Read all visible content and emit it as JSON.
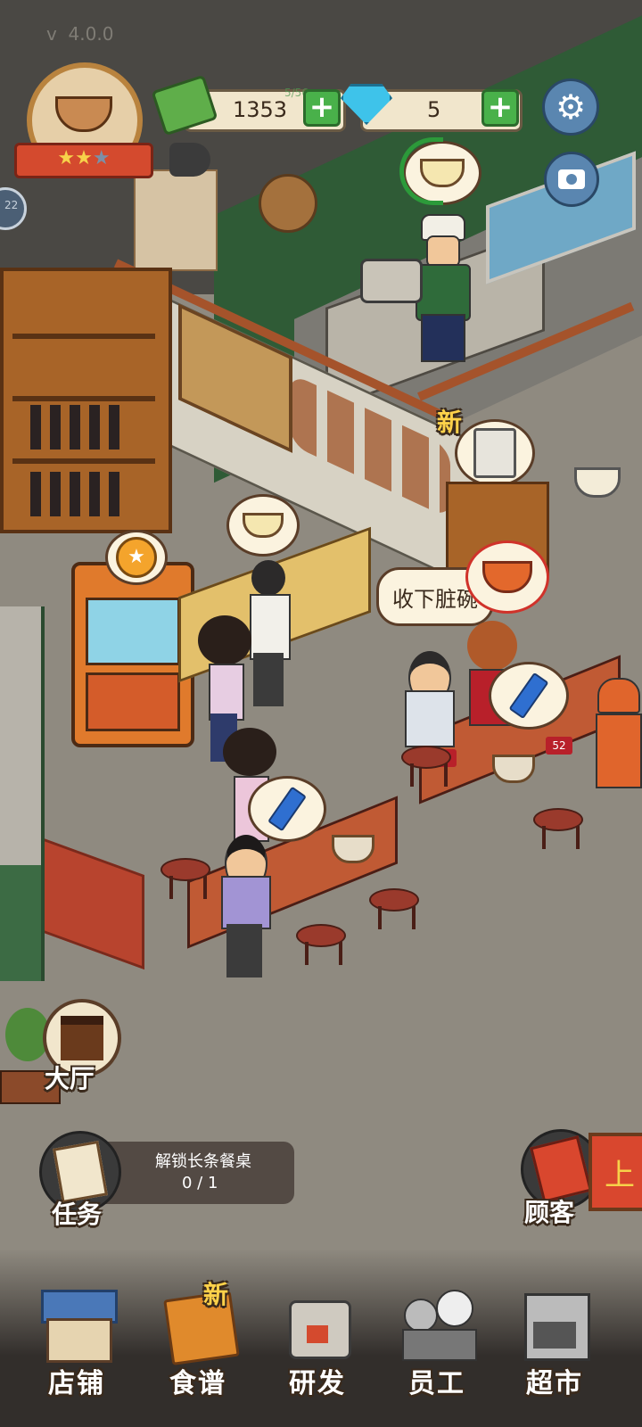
{
  "version": "v  4.0.0",
  "currency": {
    "cash": "1353",
    "cash_label_small": "5/56",
    "gems": "5"
  },
  "side_badge": "22",
  "speech": {
    "dirty_dishes": "收下脏碗"
  },
  "new_badge": "新",
  "table_numbers": [
    "54",
    "52"
  ],
  "hall_button": "大厅",
  "task": {
    "label": "任务",
    "title": "解锁长条餐桌",
    "progress": "0 / 1"
  },
  "customer_button": "顾客",
  "side_sign": "上",
  "nav": {
    "items": [
      {
        "label": "店铺",
        "icon": "shop-icon"
      },
      {
        "label": "食谱",
        "icon": "recipe-book-icon",
        "badge": "新"
      },
      {
        "label": "研发",
        "icon": "cooking-pot-icon"
      },
      {
        "label": "员工",
        "icon": "staff-icon"
      },
      {
        "label": "超市",
        "icon": "supermarket-icon"
      }
    ]
  },
  "colors": {
    "floor": "#8f8a80",
    "kitchen_floor": "#2f5b36",
    "accent_green": "#49b14a",
    "wood": "#b46b2c"
  }
}
